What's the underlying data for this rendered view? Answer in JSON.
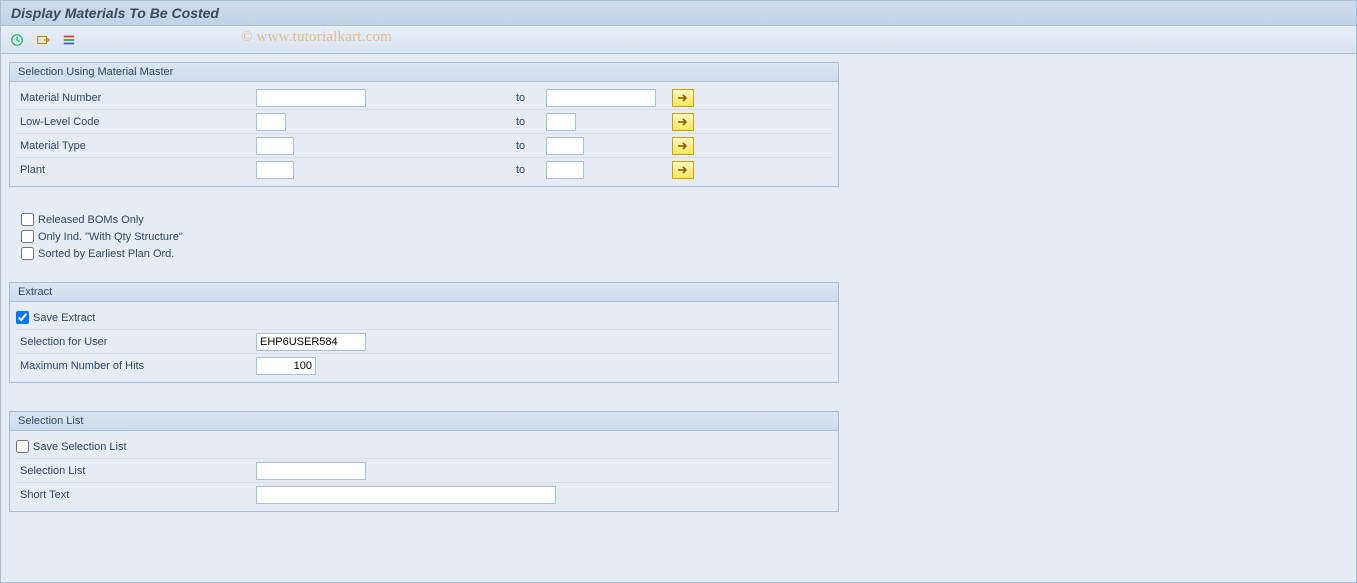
{
  "title": "Display Materials To Be Costed",
  "watermark": "© www.tutorialkart.com",
  "toolbar": {
    "execute": "Execute",
    "variant": "Get Variant",
    "layout": "Layout"
  },
  "group_selection": {
    "title": "Selection Using Material Master",
    "rows": {
      "material_number": {
        "label": "Material Number",
        "from": "",
        "to_label": "to",
        "to": ""
      },
      "low_level": {
        "label": "Low-Level Code",
        "from": "",
        "to_label": "to",
        "to": ""
      },
      "material_type": {
        "label": "Material Type",
        "from": "",
        "to_label": "to",
        "to": ""
      },
      "plant": {
        "label": "Plant",
        "from": "",
        "to_label": "to",
        "to": ""
      }
    }
  },
  "options": {
    "released_boms": "Released BOMs Only",
    "only_ind": "Only Ind. \"With Qty Structure\"",
    "sorted": "Sorted by Earliest Plan Ord."
  },
  "group_extract": {
    "title": "Extract",
    "save_extract": "Save Extract",
    "selection_for_user": {
      "label": "Selection for User",
      "value": "EHP6USER584"
    },
    "max_hits": {
      "label": "Maximum Number of Hits",
      "value": "100"
    }
  },
  "group_sel_list": {
    "title": "Selection List",
    "save_sel_list": "Save Selection List",
    "selection_list": {
      "label": "Selection List",
      "value": ""
    },
    "short_text": {
      "label": "Short Text",
      "value": ""
    }
  }
}
